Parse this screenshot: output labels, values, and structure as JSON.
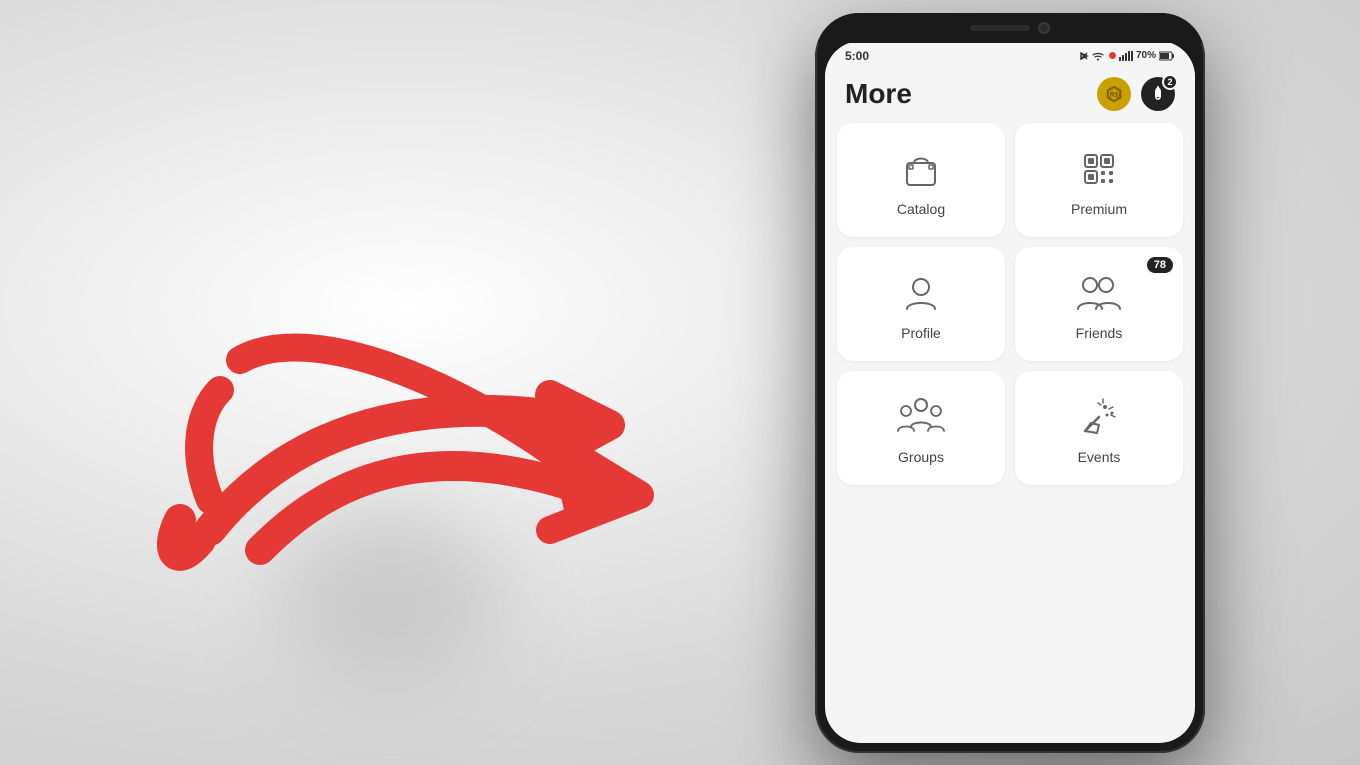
{
  "background": {
    "color": "#e0e0e0"
  },
  "phone": {
    "status_bar": {
      "time": "5:00",
      "battery": "70%",
      "signal_icons": "🔵 📶 70%"
    },
    "header": {
      "title": "More",
      "robux_icon": "hexagon",
      "notification_badge": "2"
    },
    "menu_items": [
      {
        "id": "catalog",
        "label": "Catalog",
        "icon": "shopping-bag-icon",
        "badge": null,
        "row": 0,
        "col": 0
      },
      {
        "id": "premium",
        "label": "Premium",
        "icon": "premium-icon",
        "badge": null,
        "row": 0,
        "col": 1
      },
      {
        "id": "profile",
        "label": "Profile",
        "icon": "person-icon",
        "badge": null,
        "row": 1,
        "col": 0
      },
      {
        "id": "friends",
        "label": "Friends",
        "icon": "friends-icon",
        "badge": "78",
        "row": 1,
        "col": 1
      },
      {
        "id": "groups",
        "label": "Groups",
        "icon": "groups-icon",
        "badge": null,
        "row": 2,
        "col": 0
      },
      {
        "id": "events",
        "label": "Events",
        "icon": "events-icon",
        "badge": null,
        "row": 2,
        "col": 1
      }
    ],
    "arrow": {
      "color": "#e53935",
      "direction": "right",
      "target": "profile"
    }
  }
}
